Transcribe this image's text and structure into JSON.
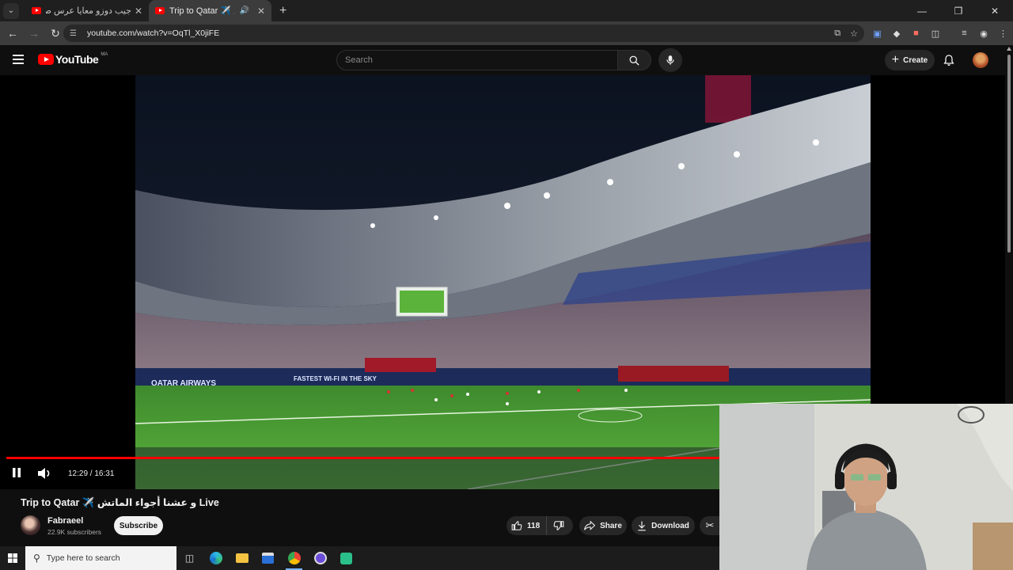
{
  "browser": {
    "tabs": [
      {
        "title": "جيب دوزو معايا عرس صاحبتي",
        "active": false
      },
      {
        "title": "Trip to Qatar ✈️ و عشنا أجواء الماتش",
        "active": true
      }
    ],
    "url": "youtube.com/watch?v=OqTl_X0jiFE"
  },
  "youtube": {
    "logo_text": "YouTube",
    "country_code": "MA",
    "search_placeholder": "Search",
    "create_label": "Create"
  },
  "player": {
    "time_current": "12:29",
    "time_total": "16:31",
    "time_display": "12:29 / 16:31",
    "progress_fraction": 0.756,
    "state": "playing"
  },
  "video": {
    "title": "Trip to Qatar ✈️ و عشنا أجواء الماتش Live",
    "channel_name": "Fabraeel",
    "subscribers": "22.9K subscribers",
    "subscribe_label": "Subscribe",
    "like_count": "118",
    "share_label": "Share",
    "download_label": "Download",
    "stadium_boards": [
      "QATAR AIRWAYS",
      "FASTEST WI-FI IN THE SKY"
    ]
  },
  "taskbar": {
    "search_placeholder": "Type here to search"
  },
  "colors": {
    "accent_red": "#ff0000",
    "background": "#0f0f0f",
    "chip": "#272727"
  }
}
